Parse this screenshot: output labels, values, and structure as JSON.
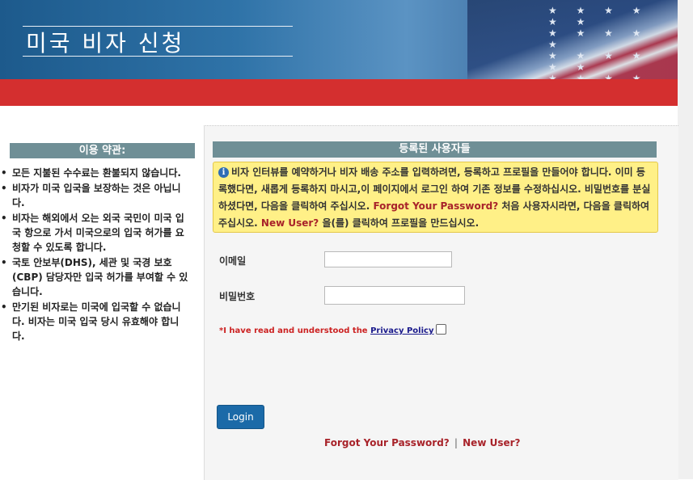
{
  "header": {
    "title": "미국 비자 신청"
  },
  "sidebar": {
    "heading": "이용 약관:",
    "terms": [
      "모든 지불된 수수료는 환불되지 않습니다.",
      "비자가 미국 입국을 보장하는 것은 아닙니다.",
      "비자는 해외에서 오는 외국 국민이 미국 입국 항으로 가서 미국으로의 입국 허가를 요청할 수 있도록 합니다.",
      "국토 안보부(DHS), 세관 및 국경 보호(CBP) 담당자만 입국 허가를 부여할 수 있습니다.",
      "만기된 비자로는 미국에 입국할 수 없습니다. 비자는 미국 입국 당시 유효해야 합니다."
    ]
  },
  "main": {
    "heading": "등록된 사용자들",
    "notice": {
      "icon": "info-icon",
      "text1": "비자 인터뷰를 예약하거나 비자 배송 주소를 입력하려면, 등록하고 프로필을 만들어야 합니다. 이미 등록했다면, 새롭게 등록하지 마시고,이 페이지에서 로그인 하여 기존 정보를 수정하십시오. 비밀번호를 분실하셨다면, 다음을 클릭하여 주십시오.",
      "forgot_link": "Forgot Your Password?",
      "text2": "처음 사용자시라면, 다음을 클릭하여 주십시오.",
      "newuser_link": "New User?",
      "text3": "을(를) 클릭하여 프로필을 만드십시오."
    },
    "email_label": "이메일",
    "email_value": "",
    "password_label": "비밀번호",
    "password_value": "",
    "policy_text": "*I have read and understood the",
    "policy_link": "Privacy Policy",
    "login_label": "Login",
    "bottom_forgot": "Forgot Your Password?",
    "bottom_separator": "|",
    "bottom_newuser": "New User?"
  },
  "colors": {
    "banner_blue": "#2f73a8",
    "red_bar": "#d42f2f",
    "header_teal": "#6f8f96",
    "notice_yellow": "#fff087",
    "link_red": "#a8232a",
    "button_blue": "#1b6aa8"
  }
}
